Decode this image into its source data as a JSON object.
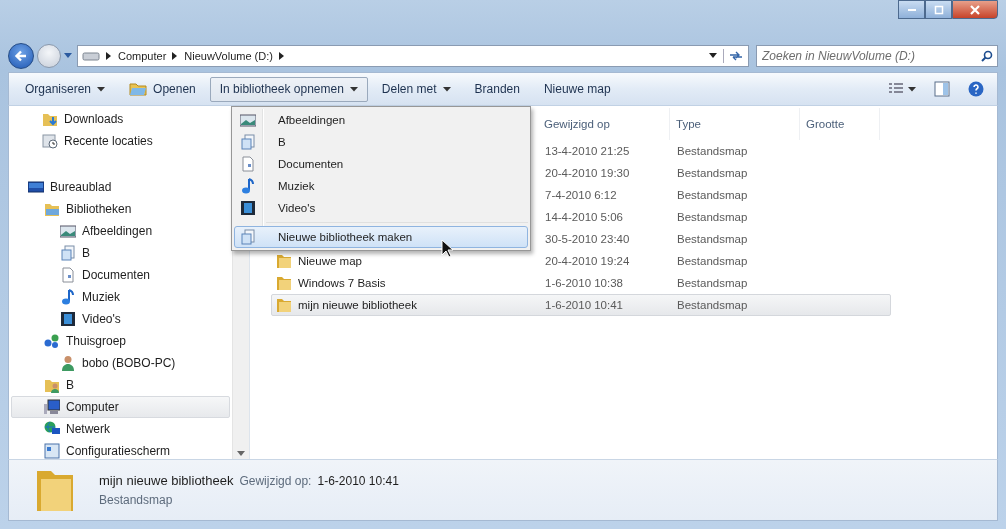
{
  "address_bar": {
    "breadcrumbs": [
      "Computer",
      "NieuwVolume (D:)"
    ],
    "search": {
      "placeholder": "Zoeken in NieuwVolume (D:)"
    }
  },
  "toolbar": {
    "items": [
      {
        "label": "Organiseren",
        "dropdown": true,
        "kind": "plain",
        "selected": false
      },
      {
        "label": "Openen",
        "dropdown": false,
        "kind": "folder",
        "selected": false
      },
      {
        "label": "In bibliotheek opnemen",
        "dropdown": true,
        "kind": "plain",
        "selected": true
      },
      {
        "label": "Delen met",
        "dropdown": true,
        "kind": "plain",
        "selected": false
      },
      {
        "label": "Branden",
        "dropdown": false,
        "kind": "plain",
        "selected": false
      },
      {
        "label": "Nieuwe map",
        "dropdown": false,
        "kind": "plain",
        "selected": false
      }
    ]
  },
  "sidebar": {
    "favorites": [
      {
        "label": "Downloads",
        "kind": "downloads",
        "selected": false
      },
      {
        "label": "Recente locaties",
        "kind": "recent",
        "selected": false
      }
    ],
    "tree": [
      {
        "label": "Bureaublad",
        "kind": "desktop",
        "selected": false,
        "children": [
          {
            "label": "Bibliotheken",
            "kind": "library",
            "selected": false,
            "children": [
              {
                "label": "Afbeeldingen",
                "kind": "pictures",
                "selected": false
              },
              {
                "label": "B",
                "kind": "library-doc",
                "selected": false
              },
              {
                "label": "Documenten",
                "kind": "document",
                "selected": false
              },
              {
                "label": "Muziek",
                "kind": "music",
                "selected": false
              },
              {
                "label": "Video's",
                "kind": "video",
                "selected": false
              }
            ]
          },
          {
            "label": "Thuisgroep",
            "kind": "homegroup",
            "selected": false,
            "children": [
              {
                "label": "bobo (BOBO-PC)",
                "kind": "user",
                "selected": false
              }
            ]
          },
          {
            "label": "B",
            "kind": "user-folder",
            "selected": false
          },
          {
            "label": "Computer",
            "kind": "computer",
            "selected": true
          },
          {
            "label": "Netwerk",
            "kind": "network",
            "selected": false
          },
          {
            "label": "Configuratiescherm",
            "kind": "control-panel",
            "selected": false
          }
        ]
      }
    ]
  },
  "file_list": {
    "columns": [
      "Gewijzigd op",
      "Type",
      "Grootte"
    ],
    "rows": [
      {
        "modified": "13-4-2010 21:25",
        "type": "Bestandsmap",
        "selected": false
      },
      {
        "modified": "20-4-2010 19:30",
        "type": "Bestandsmap",
        "selected": false
      },
      {
        "modified": "7-4-2010 6:12",
        "type": "Bestandsmap",
        "selected": false
      },
      {
        "modified": "14-4-2010 5:06",
        "type": "Bestandsmap",
        "selected": false
      },
      {
        "modified": "30-5-2010 23:40",
        "type": "Bestandsmap",
        "selected": false
      },
      {
        "name": "Nieuwe map",
        "modified": "20-4-2010 19:24",
        "type": "Bestandsmap",
        "selected": false
      },
      {
        "name": "Windows 7 Basis",
        "modified": "1-6-2010 10:38",
        "type": "Bestandsmap",
        "selected": false
      },
      {
        "name": "mijn nieuwe bibliotheek",
        "modified": "1-6-2010 10:41",
        "type": "Bestandsmap",
        "selected": true
      }
    ]
  },
  "dropdown_menu": {
    "groups": [
      [
        {
          "label": "Afbeeldingen",
          "kind": "pictures",
          "selected": false
        },
        {
          "label": "B",
          "kind": "library-doc",
          "selected": false
        },
        {
          "label": "Documenten",
          "kind": "document",
          "selected": false
        },
        {
          "label": "Muziek",
          "kind": "music",
          "selected": false
        },
        {
          "label": "Video's",
          "kind": "video",
          "selected": false
        }
      ],
      [
        {
          "label": "Nieuwe bibliotheek maken",
          "kind": "library-doc",
          "selected": true
        }
      ]
    ]
  },
  "details_pane": {
    "name": "mijn nieuwe bibliotheek",
    "modified_label": "Gewijzigd op:",
    "modified_value": "1-6-2010 10:41",
    "type": "Bestandsmap"
  }
}
